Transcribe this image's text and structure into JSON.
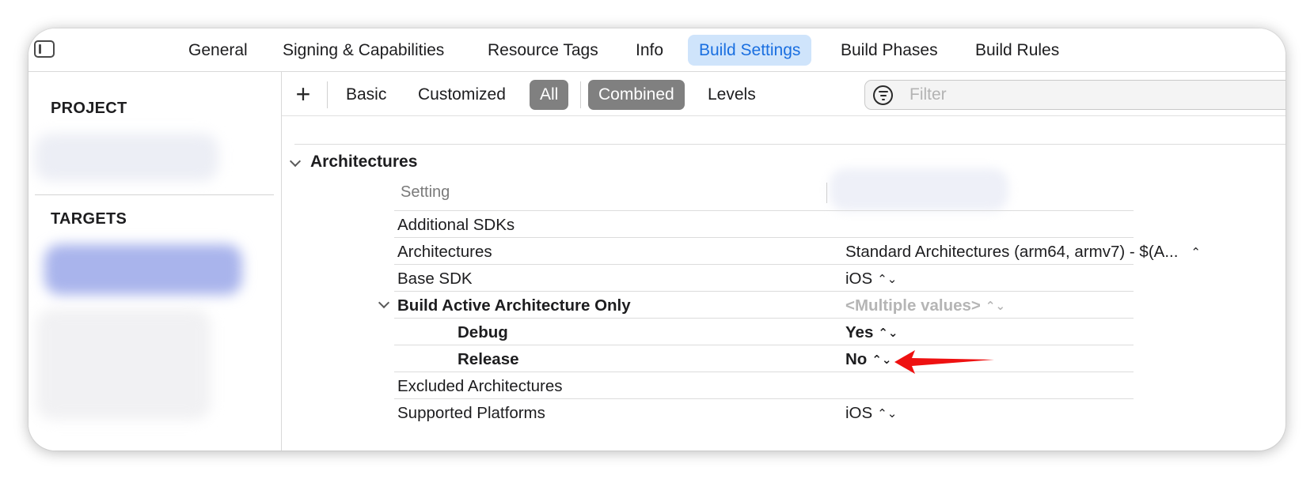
{
  "tabs": [
    {
      "label": "General",
      "active": false
    },
    {
      "label": "Signing & Capabilities",
      "active": false
    },
    {
      "label": "Resource Tags",
      "active": false
    },
    {
      "label": "Info",
      "active": false
    },
    {
      "label": "Build Settings",
      "active": true
    },
    {
      "label": "Build Phases",
      "active": false
    },
    {
      "label": "Build Rules",
      "active": false
    }
  ],
  "sidebar": {
    "project_heading": "PROJECT",
    "targets_heading": "TARGETS"
  },
  "toolbar": {
    "plus_label": "+",
    "basic_label": "Basic",
    "customized_label": "Customized",
    "all_label": "All",
    "combined_label": "Combined",
    "levels_label": "Levels",
    "filter_placeholder": "Filter"
  },
  "section": {
    "title": "Architectures",
    "column_header": "Setting"
  },
  "rows": [
    {
      "label": "Additional SDKs",
      "value": ""
    },
    {
      "label": "Architectures",
      "value": "Standard Architectures (arm64, armv7)  -  $(A...",
      "stepper": "⌃"
    },
    {
      "label": "Base SDK",
      "value": "iOS",
      "stepper": "⌃⌄"
    },
    {
      "label": "Build Active Architecture Only",
      "value": "<Multiple values>",
      "stepper": "⌃⌄"
    },
    {
      "label": "Debug",
      "value": "Yes",
      "stepper": "⌃⌄"
    },
    {
      "label": "Release",
      "value": "No",
      "stepper": "⌃⌄"
    },
    {
      "label": "Excluded Architectures",
      "value": ""
    },
    {
      "label": "Supported Platforms",
      "value": "iOS",
      "stepper": "⌃⌄"
    }
  ],
  "colors": {
    "accent": "#1a6fe0",
    "active_tab_bg": "#cfe4fb",
    "segment_selected": "#808080",
    "annotation_arrow": "#ee1111"
  },
  "icons": {
    "sidebar_toggle": "sidebar-toggle-icon",
    "filter": "filter-icon",
    "disclosure": "chevron-down-icon",
    "annotation": "red-arrow-icon"
  }
}
